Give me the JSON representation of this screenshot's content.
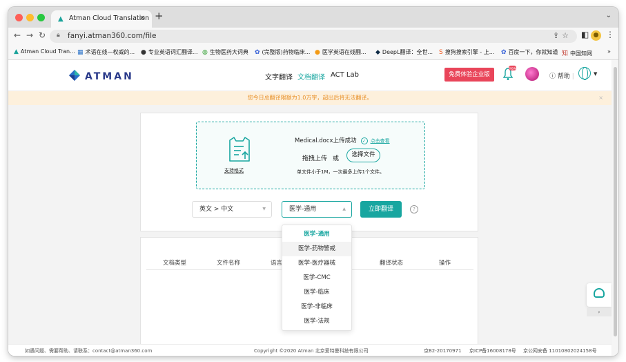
{
  "browser": {
    "tab_title": "Atman Cloud Translation",
    "new_tab": "+",
    "url": "fanyi.atman360.com/file",
    "bookmarks": [
      {
        "icon": "▲",
        "label": "Atman Cloud Tran..."
      },
      {
        "icon": "▦",
        "label": "术语在线—权威的..."
      },
      {
        "icon": "●",
        "label": "专业英语词汇翻译..."
      },
      {
        "icon": "◍",
        "label": "生物医药大词典"
      },
      {
        "icon": "✿",
        "label": "(完整版)药物临床..."
      },
      {
        "icon": "●",
        "label": "医学英语在线翻..."
      },
      {
        "icon": "◆",
        "label": "DeepL翻译：全世..."
      },
      {
        "icon": "S",
        "label": "搜狗搜索引擎 - 上..."
      },
      {
        "icon": "✿",
        "label": "百度一下，你就知道"
      },
      {
        "icon": "知",
        "label": "中国知网"
      }
    ],
    "more_bookmarks": "»"
  },
  "header": {
    "logo_text": "ATMAN",
    "nav": [
      "文字翻译",
      "文档翻译",
      "ACT Lab"
    ],
    "free_trial": "免费体验企业版",
    "bell_badge": "new",
    "help": "帮助",
    "help_sep": "|"
  },
  "notice": {
    "text": "您今日总翻译限额为1.0万字，超出后将无法翻译。",
    "close": "×"
  },
  "upload": {
    "formats_link": "支持格式",
    "success_text": "Medical.docx上传成功",
    "view_link": "点击查看",
    "drag_text": "拖拽上传",
    "or_text": "或",
    "choose_button": "选择文件",
    "rule_text": "单文件小于1M，一次最多上传1个文件。"
  },
  "controls": {
    "language": "英文 > 中文",
    "domain": "医学-通用",
    "translate_button": "立即翻译",
    "help_icon": "?"
  },
  "domain_options": [
    "医学-通用",
    "医学-药物警戒",
    "医学-医疗器械",
    "医学-CMC",
    "医学-临床",
    "医学-非临床",
    "医学-法规"
  ],
  "table": {
    "headers": [
      "文档类型",
      "文件名称",
      "语言",
      "翻译状态",
      "操作"
    ]
  },
  "side": {
    "collapse": "›"
  },
  "footer": {
    "contact": "如遇问题、需要帮助、请联系：contact@atman360.com",
    "copyright": "Copyright ©2020 Atman   北京爱特曼科技有限公司",
    "icp1": "京B2-20170971",
    "icp2": "京ICP备16008178号",
    "icp3": "京公网安备 11010802024158号"
  },
  "colors": {
    "accent": "#18a6a0",
    "danger": "#e9455a",
    "notice_bg": "#fdf0dc",
    "notice_fg": "#e8912a"
  }
}
